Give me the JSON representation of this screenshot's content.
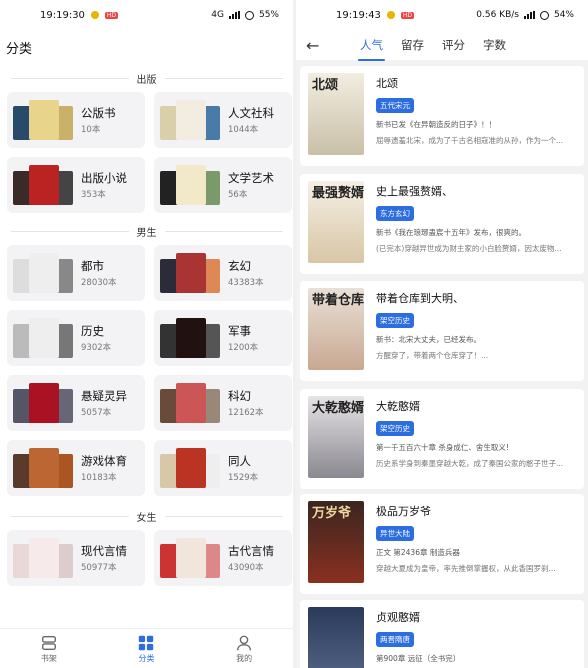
{
  "left": {
    "status": {
      "time": "19:19:30",
      "badge": "HD",
      "net": "4G",
      "battery": "55%"
    },
    "title": "分类",
    "sections": [
      {
        "label": "出版",
        "items": [
          {
            "name": "公版书",
            "count": "10本",
            "colors": [
              "#2a4a6a",
              "#e8d48a",
              "#c9b16a"
            ]
          },
          {
            "name": "人文社科",
            "count": "1044本",
            "colors": [
              "#d9cfa8",
              "#f2ede0",
              "#4a7aa8"
            ]
          },
          {
            "name": "出版小说",
            "count": "353本",
            "colors": [
              "#3a2a28",
              "#b22",
              "#444"
            ]
          },
          {
            "name": "文学艺术",
            "count": "56本",
            "colors": [
              "#222",
              "#f2e9c8",
              "#7a9a6a"
            ]
          }
        ]
      },
      {
        "label": "男生",
        "items": [
          {
            "name": "都市",
            "count": "28030本",
            "colors": [
              "#ddd",
              "#eee",
              "#888"
            ]
          },
          {
            "name": "玄幻",
            "count": "43383本",
            "colors": [
              "#2b2b3a",
              "#a33",
              "#d85"
            ]
          },
          {
            "name": "历史",
            "count": "9302本",
            "colors": [
              "#bbb",
              "#eee",
              "#777"
            ]
          },
          {
            "name": "军事",
            "count": "1200本",
            "colors": [
              "#333",
              "#211",
              "#555"
            ]
          },
          {
            "name": "悬疑灵异",
            "count": "5057本",
            "colors": [
              "#556",
              "#a12",
              "#667"
            ]
          },
          {
            "name": "科幻",
            "count": "12162本",
            "colors": [
              "#6a4a3a",
              "#c55",
              "#987"
            ]
          },
          {
            "name": "游戏体育",
            "count": "10183本",
            "colors": [
              "#5a3a2a",
              "#b63",
              "#a52"
            ]
          },
          {
            "name": "同人",
            "count": "1529本",
            "colors": [
              "#d8c8a8",
              "#b32",
              "#eee"
            ]
          }
        ]
      },
      {
        "label": "女生",
        "items": [
          {
            "name": "现代言情",
            "count": "50977本",
            "colors": [
              "#e8d8d8",
              "#f6eaea",
              "#dcc"
            ]
          },
          {
            "name": "古代言情",
            "count": "43090本",
            "colors": [
              "#c33",
              "#f0e6dc",
              "#d88"
            ]
          }
        ]
      }
    ],
    "tabs": [
      {
        "label": "书架",
        "icon": "bookshelf-icon"
      },
      {
        "label": "分类",
        "icon": "grid-icon"
      },
      {
        "label": "我的",
        "icon": "person-icon"
      }
    ]
  },
  "right": {
    "status": {
      "time": "19:19:43",
      "badge": "HD",
      "net": "0.56 KB/s",
      "battery": "54%"
    },
    "tabs": [
      "人气",
      "留存",
      "评分",
      "字数"
    ],
    "books": [
      {
        "title": "北颂",
        "tag": "五代宋元",
        "line1": "新书已发《在异朝造反的日子》！！",
        "desc": "屈辱遗羞北宋，成为了千古名相寇准的从孙，作为一个...",
        "cover_text": "北颂",
        "cover_colors": [
          "#f2ede0",
          "#c9c0a8"
        ]
      },
      {
        "title": "史上最强赘婿、",
        "tag": "东方玄幻",
        "line1": "新书《我在琅琊蛊宸十五年》发布，很爽的。",
        "desc": "(已完本)穿越异世成为财主家的小白脸赘婿，因太废物...",
        "cover_text": "最强赘婿",
        "cover_colors": [
          "#f5efe4",
          "#d8c6a6"
        ]
      },
      {
        "title": "带着仓库到大明、",
        "tag": "架空历史",
        "line1": "新书：北宋大丈夫，已经发布。",
        "desc": "方醒穿了，带着两个仓库穿了！...",
        "cover_text": "带着仓库",
        "cover_colors": [
          "#e8e0d8",
          "#c9a890"
        ]
      },
      {
        "title": "大乾憨婿",
        "tag": "架空历史",
        "line1": "第一千五百六十章 杀身成仁、舍生取义!",
        "desc": "历史系学身到秦墨穿越大乾，成了秦国公家的憨子世子...",
        "cover_text": "大乾憨婿",
        "cover_colors": [
          "#e6e4e6",
          "#8a8890"
        ]
      },
      {
        "title": "极品万岁爷",
        "tag": "异世大陆",
        "line1": "正文 第2436章 制造兵器",
        "desc": "穿越大夏成为皇帝，率先推倒掌握权，从此香国罗刹...",
        "cover_text": "万岁爷",
        "cover_colors": [
          "#3a2620",
          "#8a3020"
        ]
      },
      {
        "title": "贞观憨婿",
        "tag": "两晋隋唐",
        "line1": "第900章 远征（全书完）",
        "desc": "",
        "cover_text": "",
        "cover_colors": [
          "#2a3a5a",
          "#5a6a8a"
        ]
      }
    ]
  }
}
